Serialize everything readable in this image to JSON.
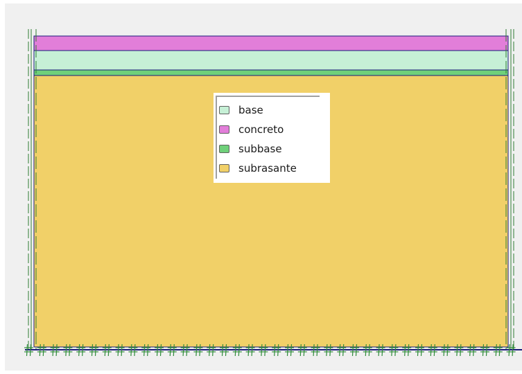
{
  "legend": {
    "items": [
      {
        "label": "base",
        "color": "#c6f0d6"
      },
      {
        "label": "concreto",
        "color": "#e27ed9"
      },
      {
        "label": "subbase",
        "color": "#6fd07a"
      },
      {
        "label": "subrasante",
        "color": "#f1d068"
      }
    ]
  },
  "colors": {
    "canvas_background": "#f0f0f0",
    "boundary_line": "#2e7d32",
    "layer_outline": "#1a1a7a",
    "fixity_marks": "#2e8b3a"
  },
  "layers_top_to_bottom": [
    "concreto",
    "base",
    "subbase",
    "subrasante"
  ],
  "support_condition_marks": "fixed-base-hashes"
}
